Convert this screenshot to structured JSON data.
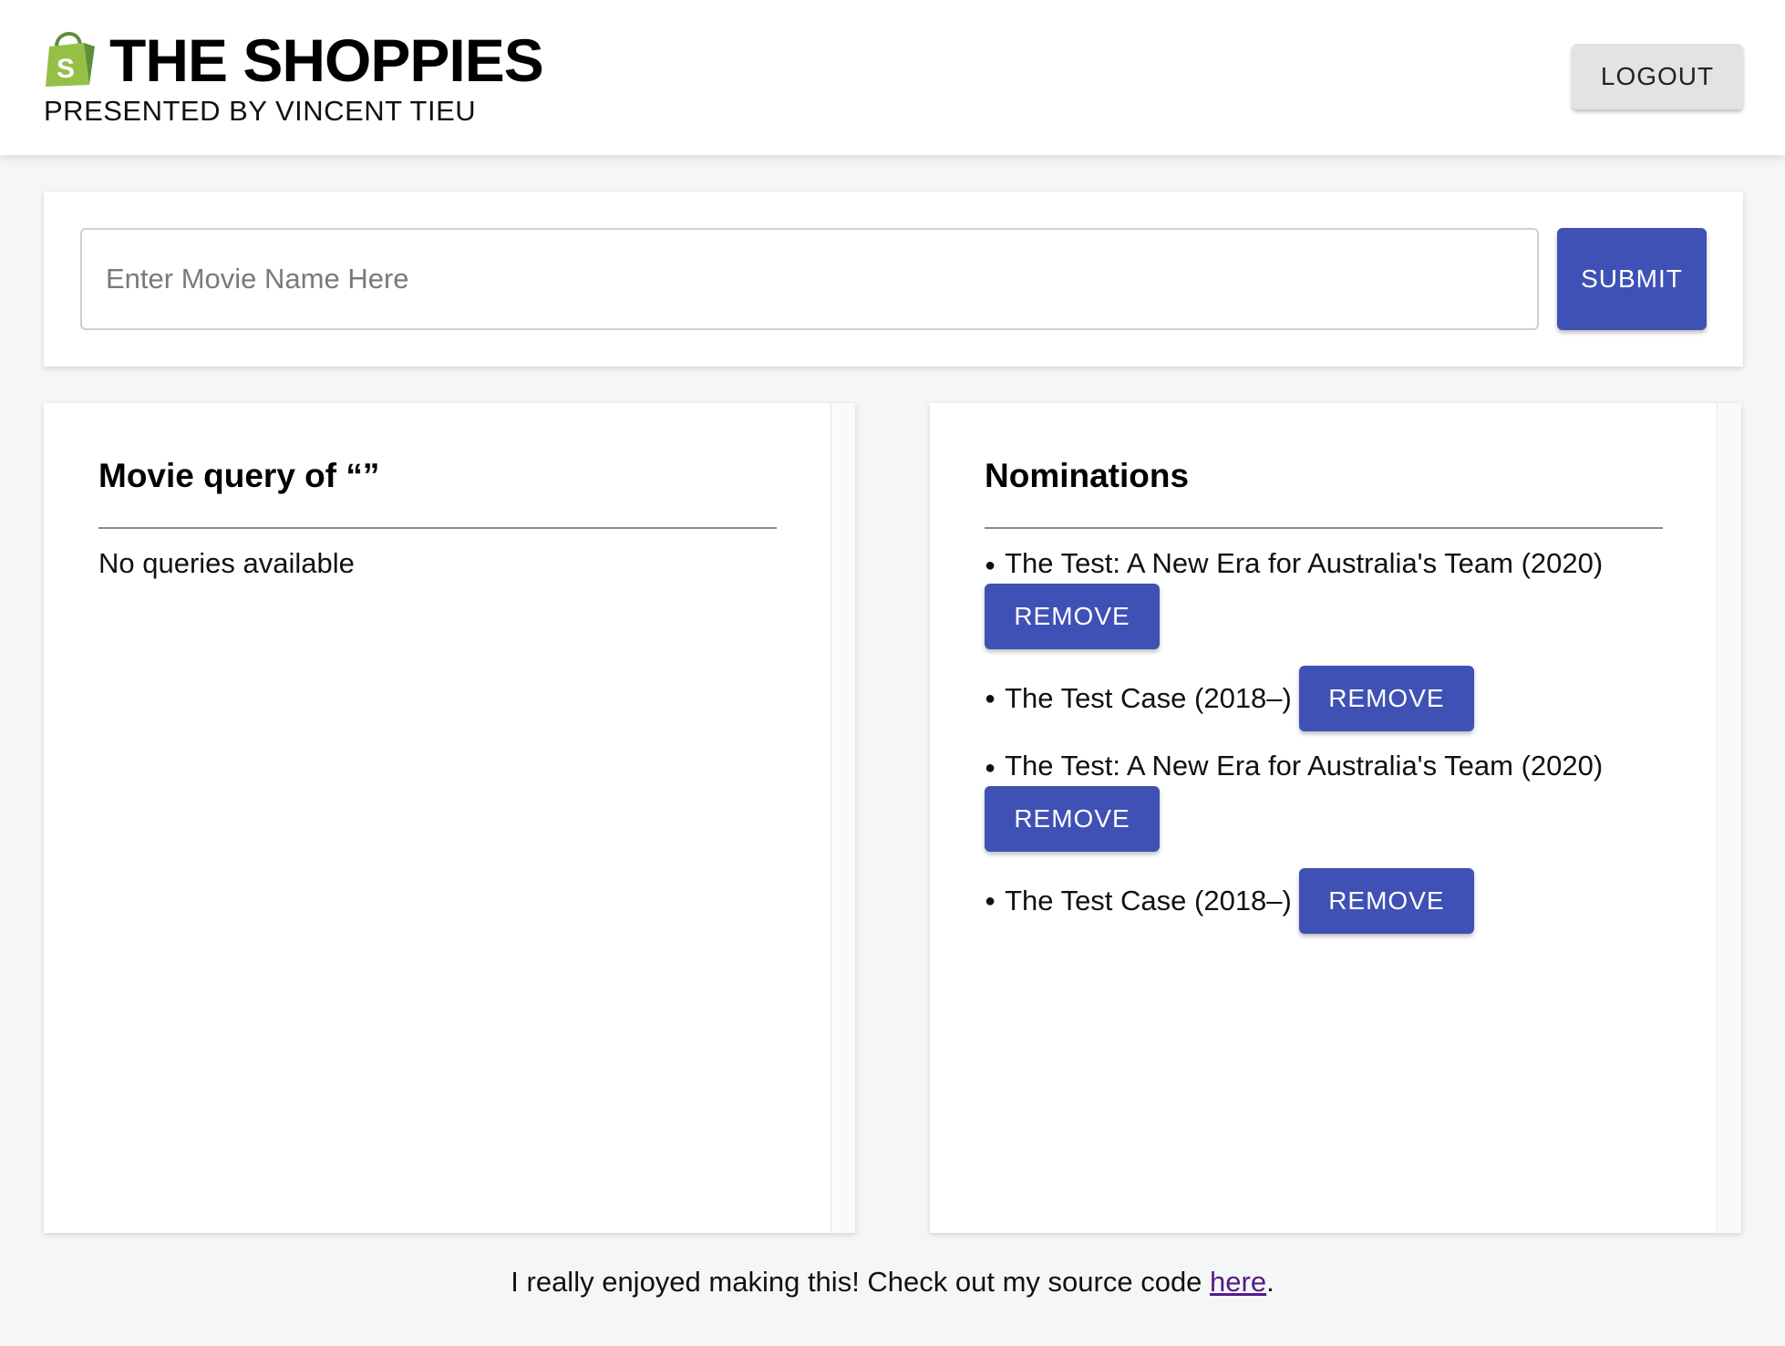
{
  "header": {
    "title": "THE SHOPPIES",
    "subtitle": "PRESENTED BY VINCENT TIEU",
    "logo_icon": "shopify-bag-icon",
    "logout_label": "LOGOUT"
  },
  "search": {
    "placeholder": "Enter Movie Name Here",
    "value": "",
    "submit_label": "SUBMIT"
  },
  "results": {
    "title": "Movie query of “”",
    "empty_text": "No queries available"
  },
  "nominations": {
    "title": "Nominations",
    "items": [
      {
        "title": "The Test: A New Era for Australia's Team (2020)",
        "remove_label": "REMOVE"
      },
      {
        "title": "The Test Case (2018–)",
        "remove_label": "REMOVE"
      },
      {
        "title": "The Test: A New Era for Australia's Team (2020)",
        "remove_label": "REMOVE"
      },
      {
        "title": "The Test Case (2018–)",
        "remove_label": "REMOVE"
      }
    ]
  },
  "footer": {
    "text": "I really enjoyed making this! Check out my source code ",
    "link_text": "here",
    "after": "."
  },
  "colors": {
    "primary": "#3f51b5",
    "logo_green": "#95bf47",
    "link": "#551a8b",
    "background": "#f4f7f5"
  }
}
